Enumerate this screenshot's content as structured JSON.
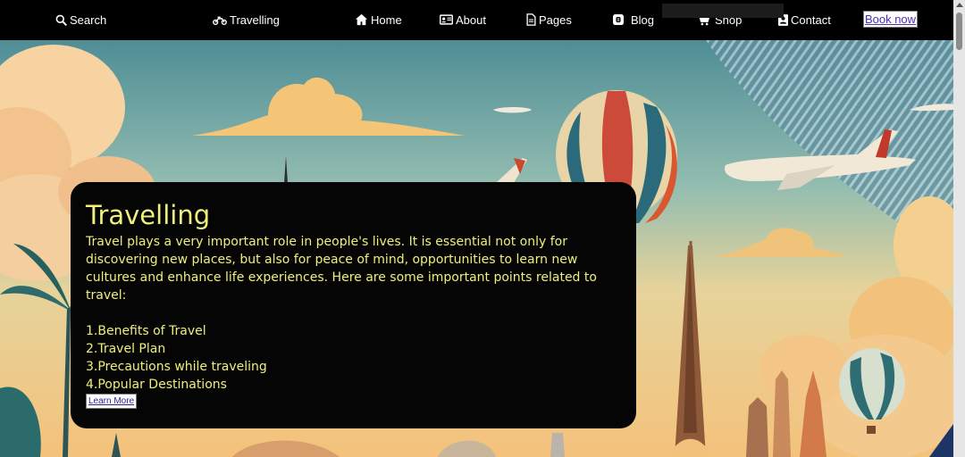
{
  "nav": {
    "search": "Search",
    "brand": "Travelling",
    "home": "Home",
    "about": "About",
    "pages": "Pages",
    "blog": "Blog",
    "shop": "Shop",
    "contact": "Contact",
    "book_now": "Book now"
  },
  "hero": {
    "title": "Travelling",
    "description": "Travel plays a very important role in people's lives. It is essential not only for discovering new places, but also for peace of mind, opportunities to learn new cultures and enhance life experiences. Here are some important points related to travel:",
    "points": [
      "1.Benefits of Travel",
      "2.Travel Plan",
      "3.Precautions while traveling",
      "4.Popular Destinations"
    ],
    "learn_more": "Learn More"
  },
  "colors": {
    "nav_bg": "#000000",
    "card_bg": "#050505",
    "card_text": "#eef07a",
    "link": "#4b2fb0"
  },
  "icons": [
    "search-icon",
    "motorcycle-icon",
    "home-icon",
    "id-card-icon",
    "file-icon",
    "blog-icon",
    "cart-icon",
    "contact-icon"
  ]
}
